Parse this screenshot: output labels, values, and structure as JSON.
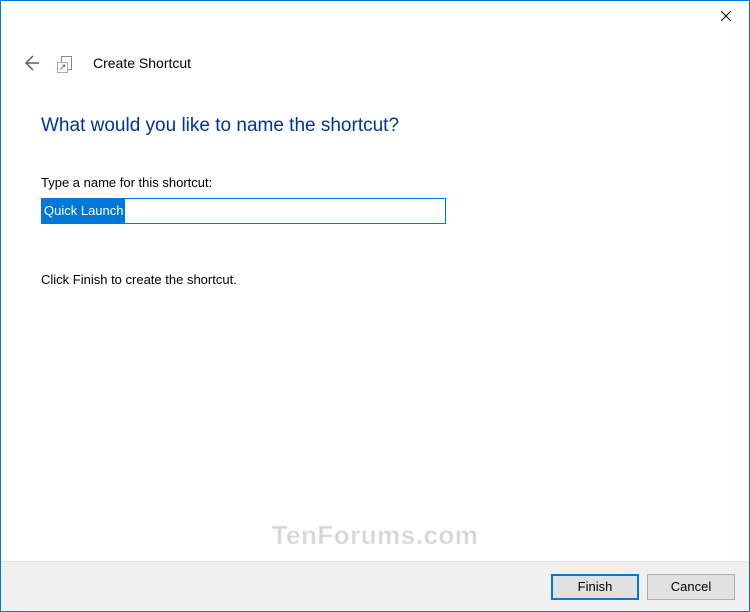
{
  "window": {
    "title": "Create Shortcut"
  },
  "content": {
    "heading": "What would you like to name the shortcut?",
    "input_label": "Type a name for this shortcut:",
    "input_value": "Quick Launch",
    "helper_text": "Click Finish to create the shortcut."
  },
  "buttons": {
    "finish": "Finish",
    "cancel": "Cancel"
  },
  "watermark": "TenForums.com"
}
